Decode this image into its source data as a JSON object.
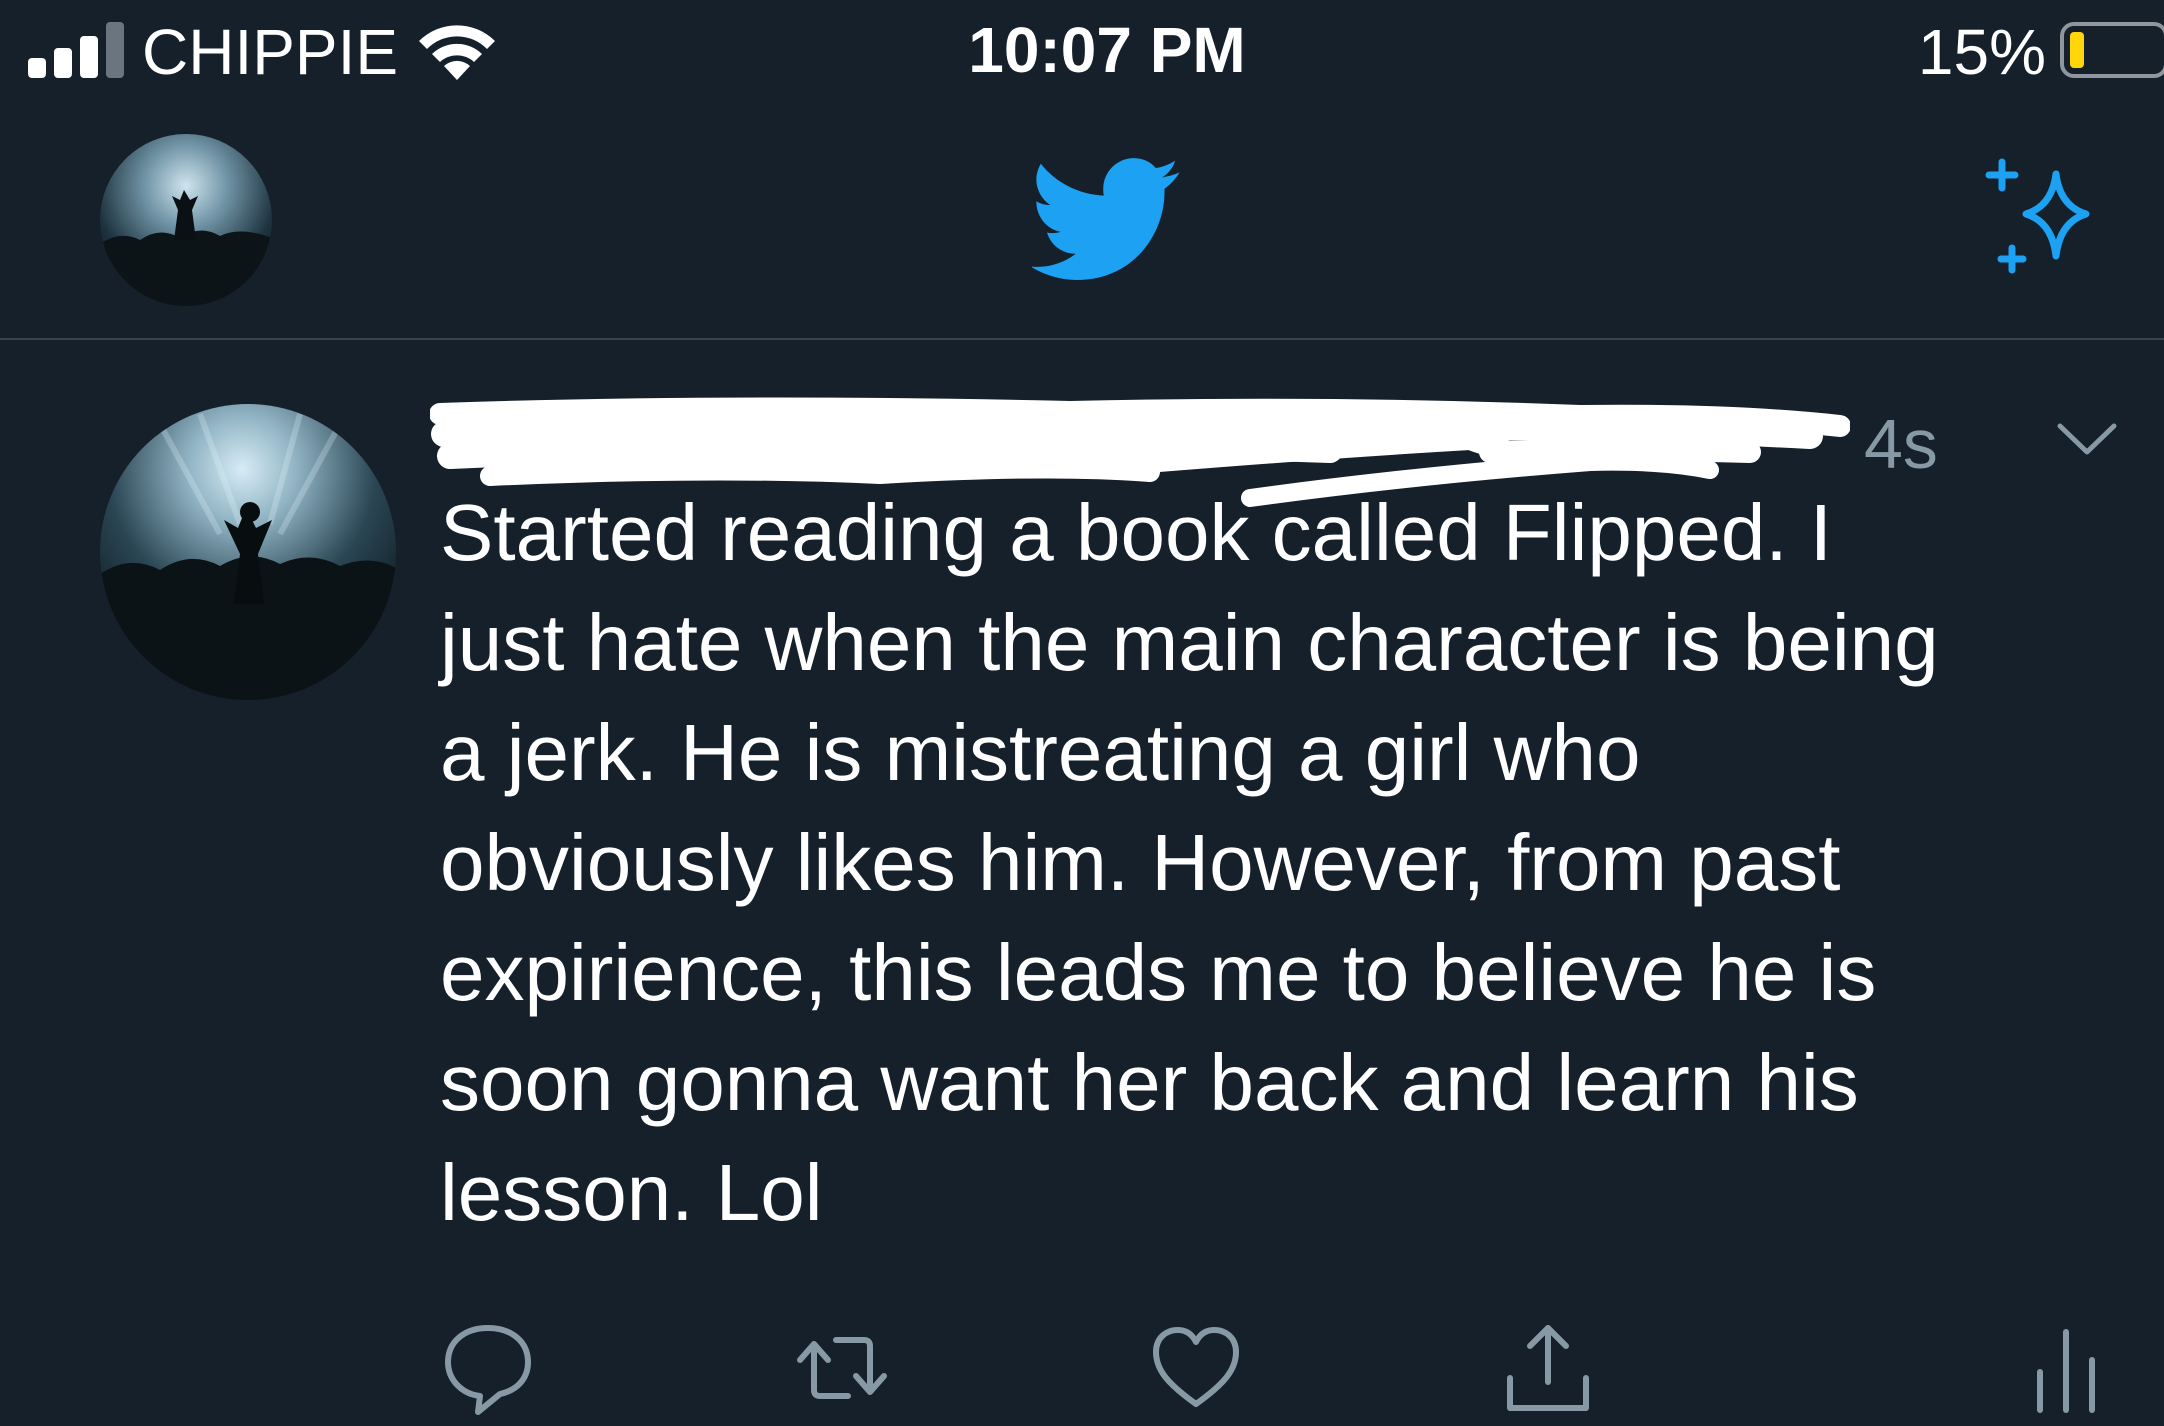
{
  "status_bar": {
    "carrier": "CHIPPIE",
    "time": "10:07 PM",
    "battery_percent": "15%",
    "icons": [
      "signal-bars-icon",
      "wifi-icon",
      "battery-icon"
    ]
  },
  "header": {
    "icons": [
      "profile-avatar",
      "twitter-bird-icon",
      "sparkle-icon"
    ]
  },
  "tweet": {
    "timestamp": "4s",
    "text_lines": [
      "Started reading a book called Flipped. I",
      "just hate when the main character is being",
      "a jerk. He is mistreating a girl who",
      "obviously likes him. However, from past",
      "expirience, this leads me to believe he is",
      "soon gonna want her back and learn his",
      "lesson. Lol"
    ],
    "actions": [
      "reply-icon",
      "retweet-icon",
      "like-icon",
      "share-icon",
      "analytics-icon"
    ]
  },
  "colors": {
    "background": "#15202b",
    "accent": "#1da1f2",
    "muted": "#8899a6",
    "divider": "#38444d"
  }
}
